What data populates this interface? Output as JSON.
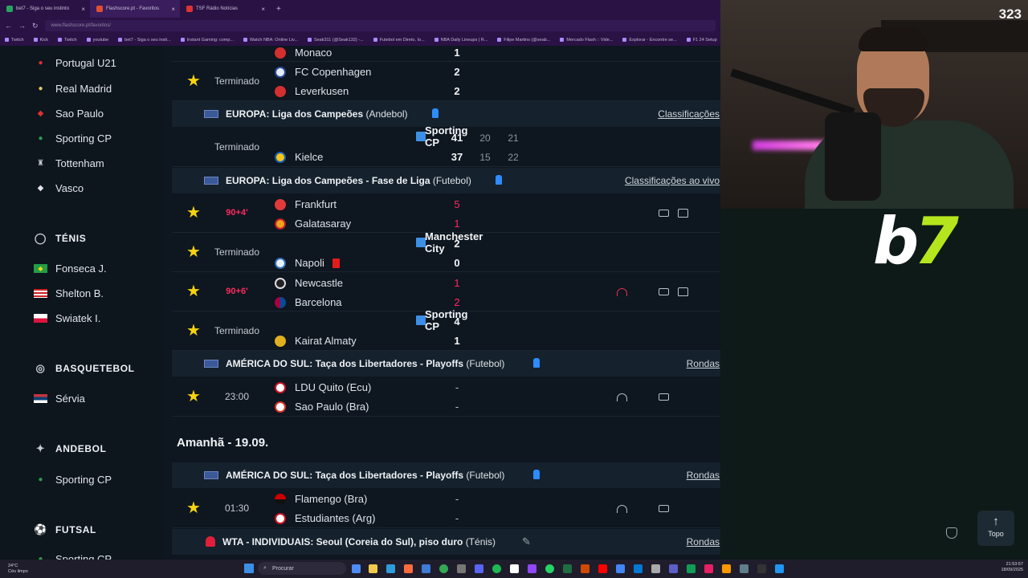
{
  "browser": {
    "tabs": [
      {
        "label": "bet7 - Siga o seu instinto"
      },
      {
        "label": "Flashscore.pt - Favoritos"
      },
      {
        "label": "TSF Rádio Notícias"
      }
    ],
    "url": "www.flashscore.pt/favoritos/",
    "bookmarks": [
      "Twitch",
      "Kick",
      "Twitch",
      "youtube",
      "bet7 - Siga o seu insti...",
      "Instant Gaming: comp...",
      "Watch NBA: Online Liv...",
      "Seak311 (@Seak132) -...",
      "Futebol em Direto, Io...",
      "NBA Daily Lineups | R...",
      "Filipe Martins (@seab...",
      "Mercado Flash :: Vide...",
      "Explorar - Encontre se...",
      "F1 24 Setup"
    ]
  },
  "sidebar": {
    "teams": [
      {
        "label": "Portugal U21",
        "icon": "portugal-crest-icon"
      },
      {
        "label": "Real Madrid",
        "icon": "real-madrid-crest-icon"
      },
      {
        "label": "Sao Paulo",
        "icon": "sao-paulo-crest-icon"
      },
      {
        "label": "Sporting CP",
        "icon": "sporting-crest-icon"
      },
      {
        "label": "Tottenham",
        "icon": "tottenham-crest-icon"
      },
      {
        "label": "Vasco",
        "icon": "vasco-crest-icon"
      }
    ],
    "tenis_title": "TÉNIS",
    "tenis": [
      {
        "label": "Fonseca J.",
        "icon": "brazil-flag-icon"
      },
      {
        "label": "Shelton B.",
        "icon": "usa-flag-icon"
      },
      {
        "label": "Swiatek I.",
        "icon": "poland-flag-icon"
      }
    ],
    "basket_title": "BASQUETEBOL",
    "basket": [
      {
        "label": "Sérvia",
        "icon": "serbia-flag-icon"
      }
    ],
    "andebol_title": "ANDEBOL",
    "andebol": [
      {
        "label": "Sporting CP",
        "icon": "sporting-crest-icon"
      }
    ],
    "futsal_title": "FUTSAL",
    "futsal": [
      {
        "label": "Sporting CP",
        "icon": "sporting-crest-icon"
      }
    ]
  },
  "matches": {
    "m0": {
      "home": "Monaco",
      "home_score": "1"
    },
    "m1": {
      "status": "Terminado",
      "home": "FC Copenhagen",
      "away": "Leverkusen",
      "home_score": "2",
      "away_score": "2"
    },
    "l1": {
      "country": "EUROPA:",
      "league": "Liga dos Campeões",
      "sport": "(Andebol)",
      "link": "Classificações"
    },
    "m2": {
      "status": "Terminado",
      "home": "Sporting CP",
      "away": "Kielce",
      "home_score": "41",
      "away_score": "37",
      "h1": "20",
      "h2": "21",
      "a1": "15",
      "a2": "22"
    },
    "l2": {
      "country": "EUROPA:",
      "league": "Liga dos Campeões - Fase de Liga",
      "sport": "(Futebol)",
      "link": "Classificações ao vivo"
    },
    "m3": {
      "status": "90+4'",
      "home": "Frankfurt",
      "away": "Galatasaray",
      "home_score": "5",
      "away_score": "1"
    },
    "m4": {
      "status": "Terminado",
      "home": "Manchester City",
      "away": "Napoli",
      "home_score": "2",
      "away_score": "0"
    },
    "m5": {
      "status": "90+6'",
      "home": "Newcastle",
      "away": "Barcelona",
      "home_score": "1",
      "away_score": "2"
    },
    "m6": {
      "status": "Terminado",
      "home": "Sporting CP",
      "away": "Kairat Almaty",
      "home_score": "4",
      "away_score": "1"
    },
    "l3": {
      "country": "AMÉRICA DO SUL:",
      "league": "Taça dos Libertadores - Playoffs",
      "sport": "(Futebol)",
      "link": "Rondas"
    },
    "m7": {
      "status": "23:00",
      "home": "LDU Quito (Ecu)",
      "away": "Sao Paulo (Bra)",
      "home_score": "-",
      "away_score": "-"
    },
    "day": "Amanhã - 19.09.",
    "l4": {
      "country": "AMÉRICA DO SUL:",
      "league": "Taça dos Libertadores - Playoffs",
      "sport": "(Futebol)",
      "link": "Rondas"
    },
    "m8": {
      "status": "01:30",
      "home": "Flamengo (Bra)",
      "away": "Estudiantes (Arg)",
      "home_score": "-",
      "away_score": "-"
    },
    "l5": {
      "country": "WTA - INDIVIDUAIS:",
      "league": "Seoul (Coreia do Sul), piso duro",
      "sport": "(Ténis)",
      "link": "Rondas"
    }
  },
  "stream": {
    "viewer_count": "323",
    "logo_b": "b",
    "logo_7": "7",
    "topo_label": "Topo"
  },
  "taskbar": {
    "weather_temp": "24°C",
    "weather_text": "Céu limpo",
    "search": "Procurar",
    "time": "21:53:57",
    "date": "18/09/2025"
  },
  "colors": {
    "accent": "#f5d311",
    "live": "#ff2a5f",
    "brand_green": "#b5e61d"
  }
}
